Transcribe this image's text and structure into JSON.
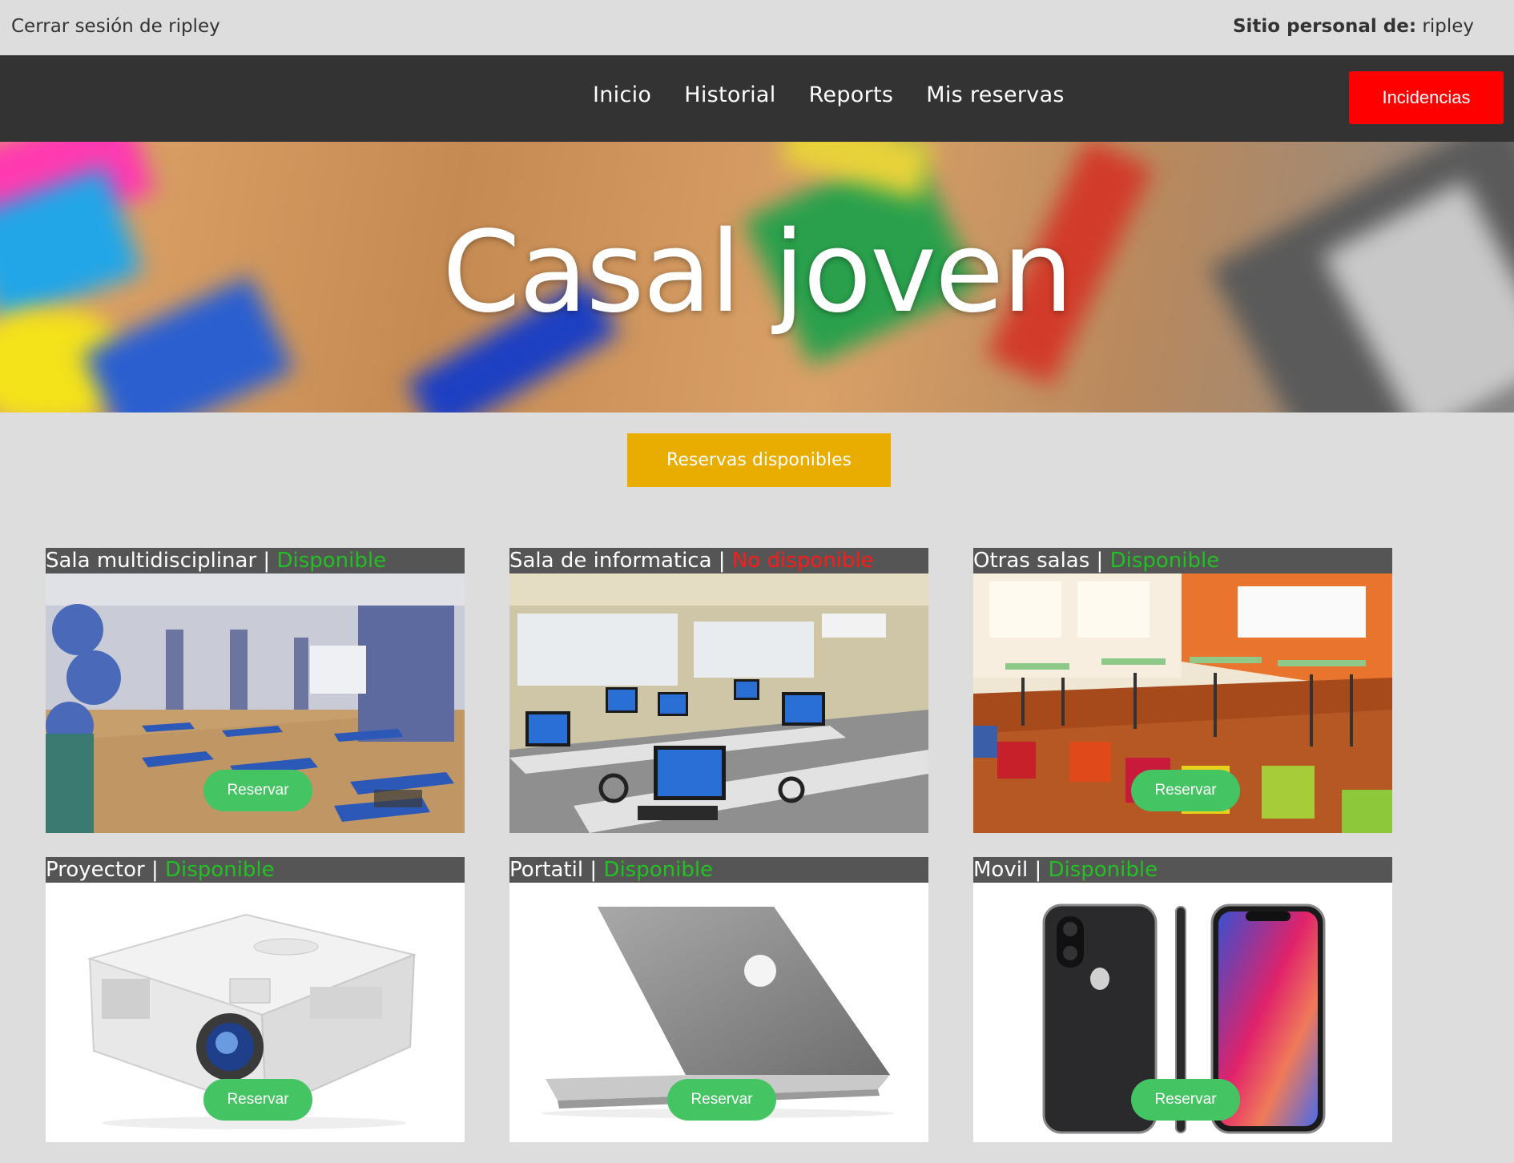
{
  "header": {
    "logout_text": "Cerrar sesión de ripley",
    "personal_label": "Sitio personal de:",
    "personal_user": "ripley"
  },
  "nav": {
    "items": [
      {
        "label": "Inicio"
      },
      {
        "label": "Historial"
      },
      {
        "label": "Reports"
      },
      {
        "label": "Mis reservas"
      }
    ],
    "incidencias_label": "Incidencias"
  },
  "hero": {
    "title": "Casal joven"
  },
  "reservas_button": "Reservas disponibles",
  "cards": [
    {
      "name": "Sala multidisciplinar",
      "status": "Disponible",
      "available": true,
      "button": "Reservar"
    },
    {
      "name": "Sala de informatica",
      "status": "No disponible",
      "available": false
    },
    {
      "name": "Otras salas",
      "status": "Disponible",
      "available": true,
      "button": "Reservar"
    },
    {
      "name": "Proyector",
      "status": "Disponible",
      "available": true,
      "button": "Reservar"
    },
    {
      "name": "Portatil",
      "status": "Disponible",
      "available": true,
      "button": "Reservar"
    },
    {
      "name": "Movil",
      "status": "Disponible",
      "available": true,
      "button": "Reservar"
    }
  ],
  "separator": "|",
  "colors": {
    "nav_bg": "#333333",
    "incidencias_bg": "#ff0000",
    "reservas_bg": "#e8ad00",
    "reservar_bg": "#45c464",
    "status_available": "#22c022",
    "status_unavailable": "#ff1a1a"
  }
}
